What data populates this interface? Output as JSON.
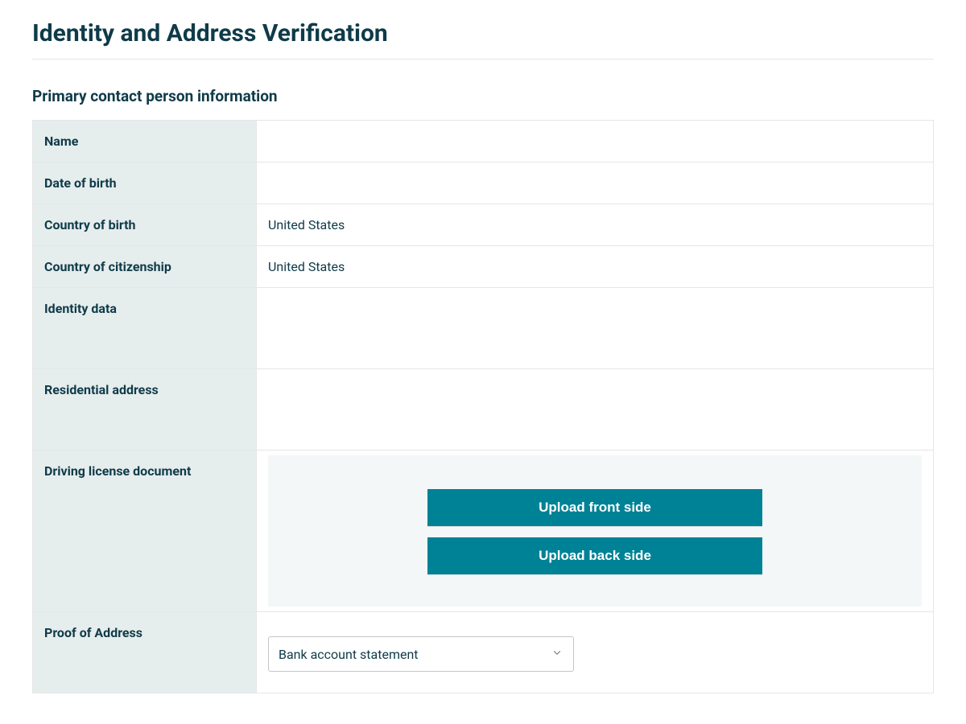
{
  "page_title": "Identity and Address Verification",
  "section_title": "Primary contact person information",
  "rows": {
    "name": {
      "label": "Name",
      "value": ""
    },
    "dob": {
      "label": "Date of birth",
      "value": ""
    },
    "country_birth": {
      "label": "Country of birth",
      "value": "United States"
    },
    "country_citizenship": {
      "label": "Country of citizenship",
      "value": "United States"
    },
    "identity_data": {
      "label": "Identity data",
      "value": ""
    },
    "residential_address": {
      "label": "Residential address",
      "value": ""
    },
    "driving_license": {
      "label": "Driving license document"
    },
    "proof_of_address": {
      "label": "Proof of Address"
    }
  },
  "buttons": {
    "upload_front": "Upload front side",
    "upload_back": "Upload back side"
  },
  "proof_select": {
    "selected": "Bank account statement"
  },
  "colors": {
    "primary": "#008296",
    "label_bg": "#E6EDED",
    "text": "#0F3B49"
  }
}
